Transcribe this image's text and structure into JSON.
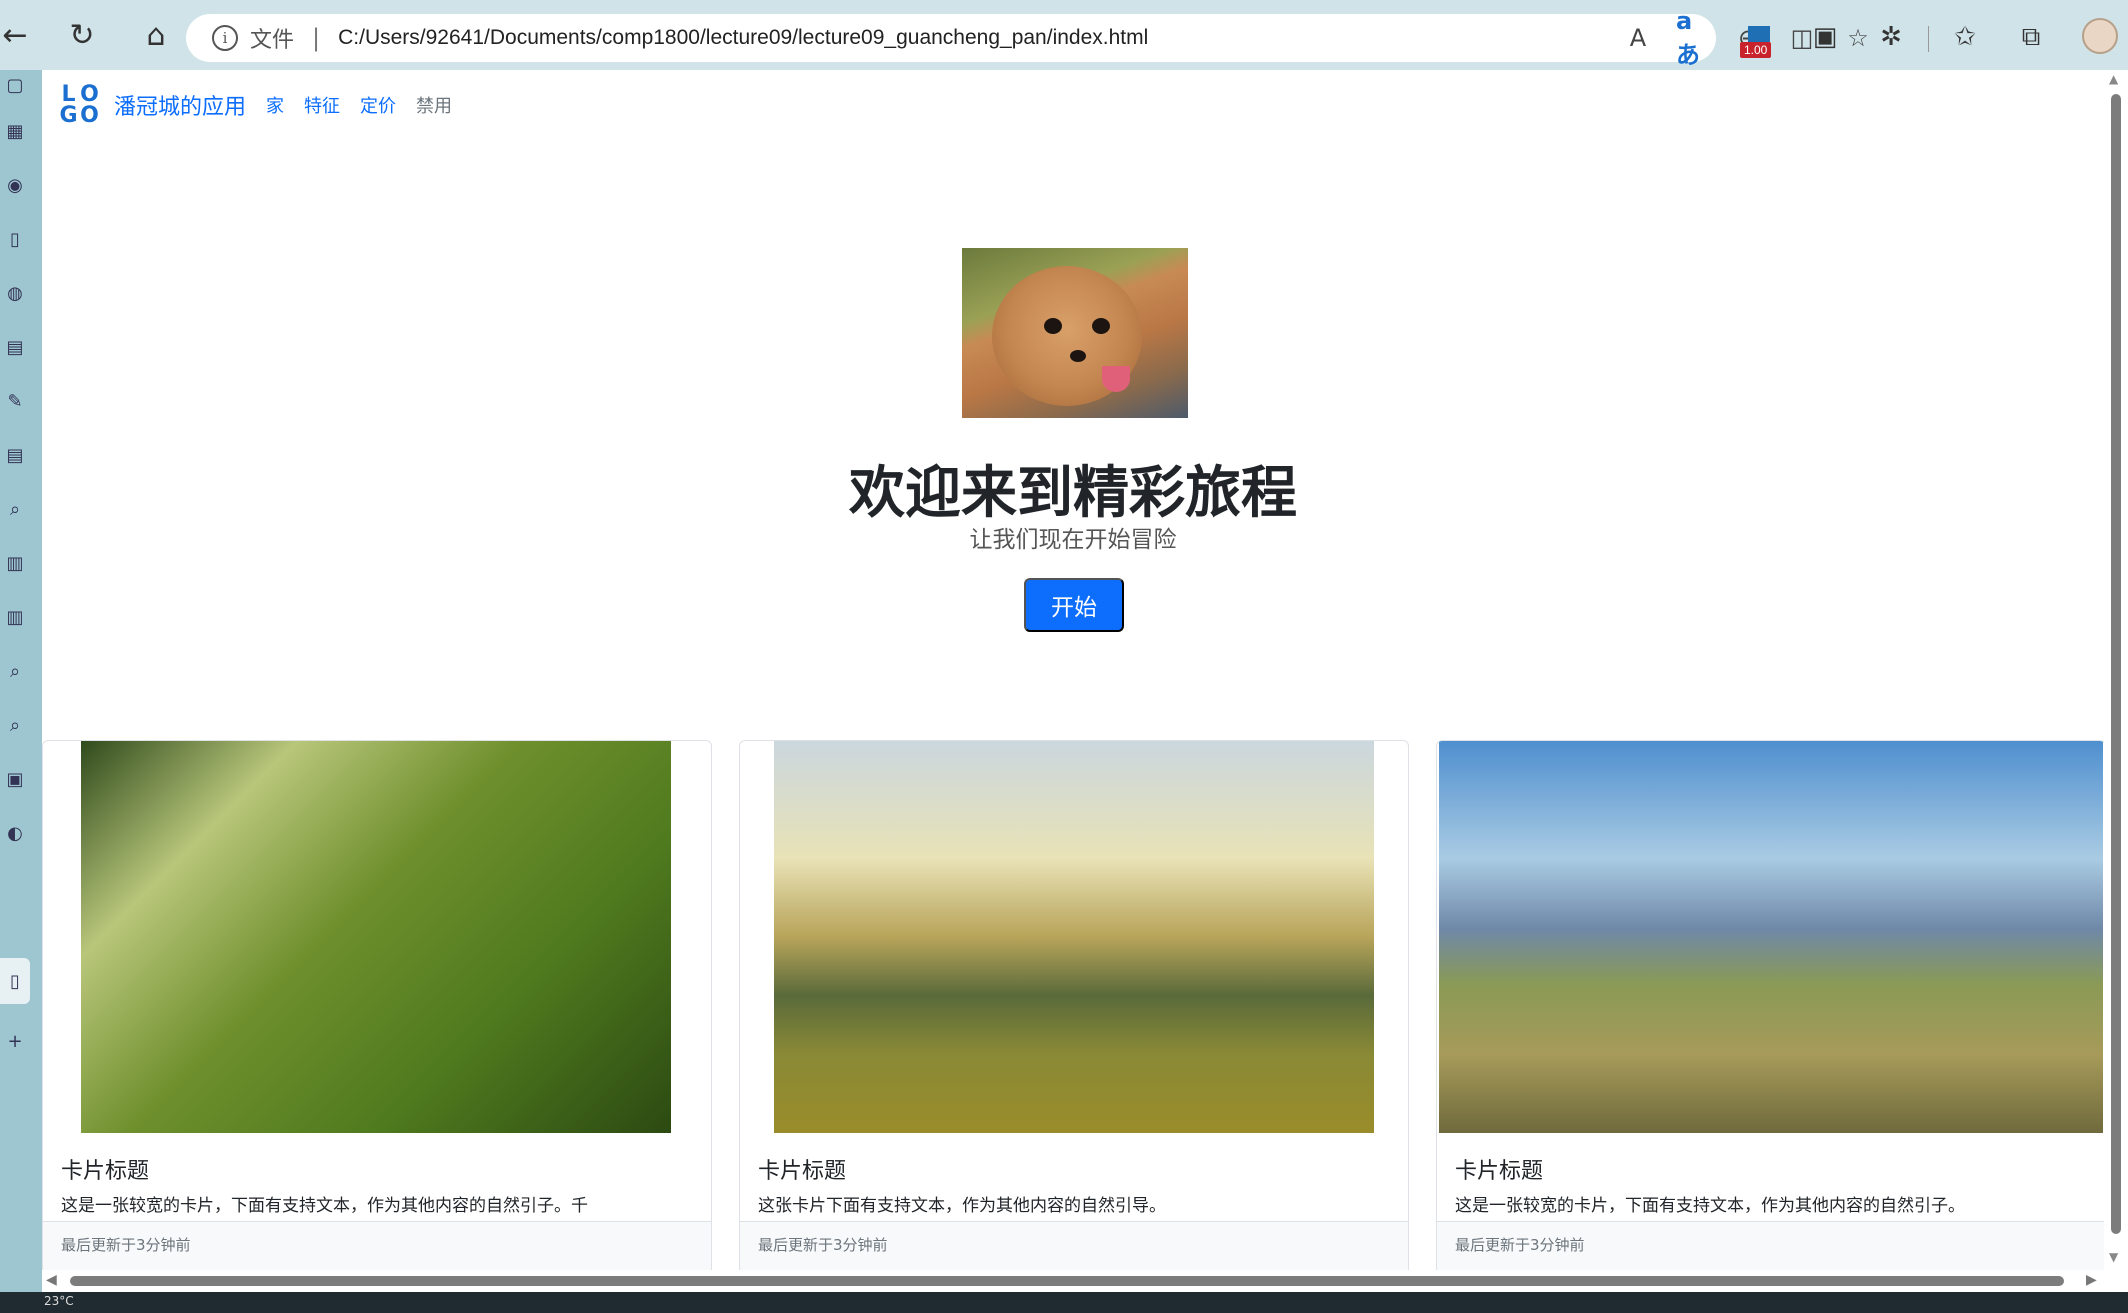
{
  "browser": {
    "address": {
      "file_label": "文件",
      "separator": "|",
      "url": "C:/Users/92641/Documents/comp1800/lecture09/lecture09_guancheng_pan/index.html"
    },
    "extension_badge": "1.00"
  },
  "navbar": {
    "logo_letters": [
      "L",
      "O",
      "G",
      "O"
    ],
    "brand": "潘冠城的应用",
    "links": [
      {
        "label": "家",
        "state": "active"
      },
      {
        "label": "特征",
        "state": "active"
      },
      {
        "label": "定价",
        "state": "active"
      },
      {
        "label": "禁用",
        "state": "disabled"
      }
    ]
  },
  "hero": {
    "title": "欢迎来到精彩旅程",
    "subtitle": "让我们现在开始冒险",
    "button": "开始"
  },
  "cards": [
    {
      "title": "卡片标题",
      "text": "这是一张较宽的卡片，下面有支持文本，作为其他内容的自然引子。千",
      "footer": "最后更新于3分钟前"
    },
    {
      "title": "卡片标题",
      "text": "这张卡片下面有支持文本，作为其他内容的自然引导。",
      "footer": "最后更新于3分钟前"
    },
    {
      "title": "卡片标题",
      "text": "这是一张较宽的卡片，下面有支持文本，作为其他内容的自然引子。",
      "footer": "最后更新于3分钟前"
    }
  ],
  "taskbar": {
    "weather": "23°C"
  },
  "colors": {
    "primary": "#0d6efd",
    "muted": "#6c757d",
    "chrome": "#cfe3e8",
    "sidebar": "#9ec6d0"
  }
}
